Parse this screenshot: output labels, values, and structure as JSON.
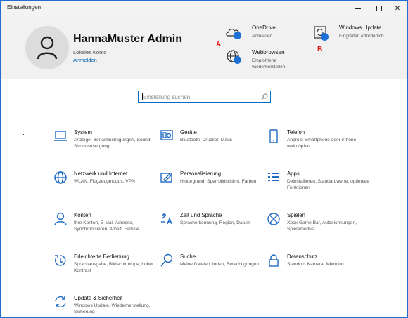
{
  "window": {
    "title": "Einstellungen",
    "controls": {
      "minimize": "–",
      "maximize": "☐",
      "close": "✕"
    }
  },
  "account": {
    "name": "HannaMuster Admin",
    "type": "Lokales Konto",
    "signin_link": "Anmelden"
  },
  "quick_links": [
    {
      "title": "OneDrive",
      "subtitle": "Anmelden",
      "icon": "cloud-icon"
    },
    {
      "title": "Webbrowsen",
      "subtitle": "Empfohlene\nwiederherstellen",
      "icon": "globe-icon"
    },
    {
      "title": "Windows Update",
      "subtitle": "Eingreifen erforderlich",
      "icon": "update-icon"
    }
  ],
  "markers": {
    "a": "A",
    "b": "B"
  },
  "search": {
    "placeholder": "Einstellung suchen"
  },
  "categories": [
    {
      "title": "System",
      "subtitle": "Anzeige, Benachrichtigungen, Sound, Stromversorgung",
      "icon": "laptop-icon"
    },
    {
      "title": "Geräte",
      "subtitle": "Bluetooth, Drucker, Maus",
      "icon": "devices-icon"
    },
    {
      "title": "Telefon",
      "subtitle": "Android-Smartphone oder iPhone verknüpfen",
      "icon": "phone-icon"
    },
    {
      "title": "Netzwerk und Internet",
      "subtitle": "WLAN, Flugzeugmodus, VPN",
      "icon": "globe-icon"
    },
    {
      "title": "Personalisierung",
      "subtitle": "Hintergrund, Sperrbildschirm, Farben",
      "icon": "paint-icon"
    },
    {
      "title": "Apps",
      "subtitle": "Deinstallieren, Standardwerte, optionale Funktionen",
      "icon": "apps-list-icon"
    },
    {
      "title": "Konten",
      "subtitle": "Ihre Konten, E-Mail-Adresse, Synchronisieren, Arbeit, Familie",
      "icon": "person-icon"
    },
    {
      "title": "Zeit und Sprache",
      "subtitle": "Spracherkennung, Region, Datum",
      "icon": "time-language-icon"
    },
    {
      "title": "Spielen",
      "subtitle": "Xbox Game Bar, Aufzeichnungen, Spielemodus",
      "icon": "xbox-icon"
    },
    {
      "title": "Erleichterte Bedienung",
      "subtitle": "Sprachausgabe, Bildschirmlupe, hoher Kontrast",
      "icon": "accessibility-icon"
    },
    {
      "title": "Suche",
      "subtitle": "Meine Dateien finden, Berechtigungen",
      "icon": "search-icon"
    },
    {
      "title": "Datenschutz",
      "subtitle": "Standort, Kamera, Mikrofon",
      "icon": "lock-icon"
    },
    {
      "title": "Update & Sicherheit",
      "subtitle": "Windows Update, Wiederherstellung, Sicherung",
      "icon": "sync-icon"
    }
  ],
  "colors": {
    "accent": "#1f6bc4",
    "badge": "#1d6fd6",
    "marker": "#dd1111",
    "header_bg": "#f1f1f1"
  }
}
